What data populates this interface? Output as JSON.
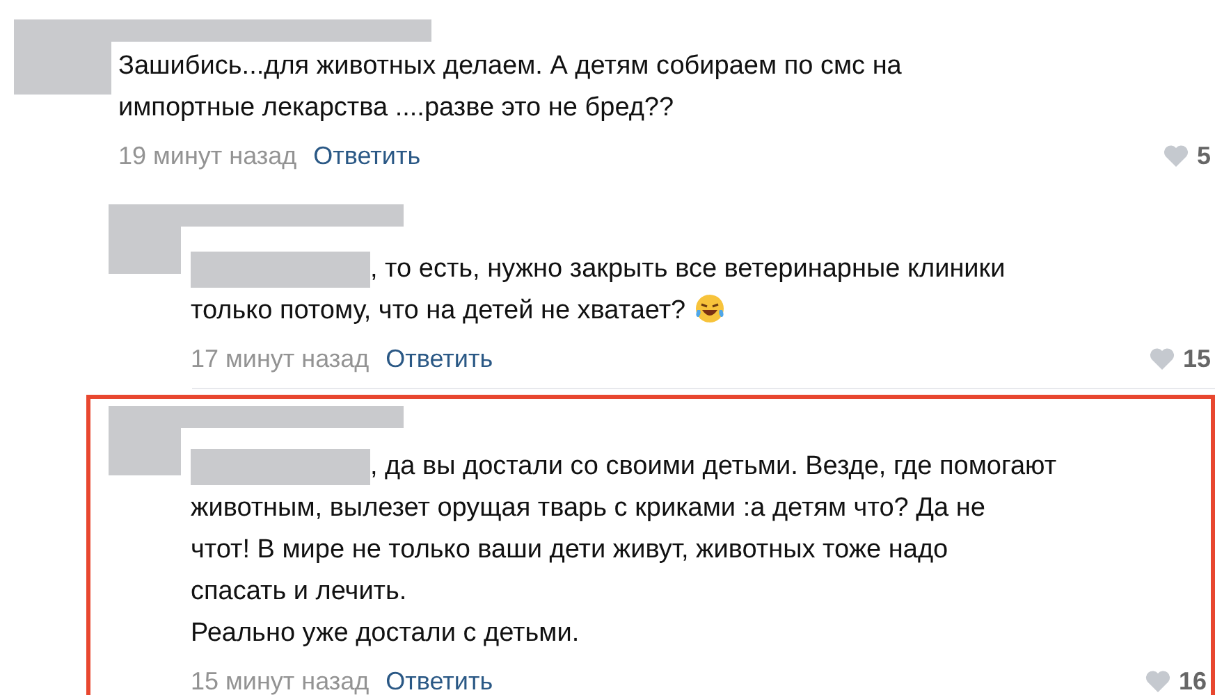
{
  "comments": [
    {
      "redacted_reply_to": false,
      "highlighted": false,
      "trailing_emoji": false,
      "lines": [
        "Зашибись...для животных делаем. А детям собираем по смс на",
        "импортные лекарства ....разве это не бред??"
      ],
      "time": "19 минут назад",
      "reply": "Ответить",
      "likes": "5"
    },
    {
      "redacted_reply_to": true,
      "highlighted": false,
      "trailing_emoji": true,
      "lines": [
        ", то есть, нужно закрыть все ветеринарные клиники",
        "только потому, что на детей не хватает?"
      ],
      "time": "17 минут назад",
      "reply": "Ответить",
      "likes": "15"
    },
    {
      "redacted_reply_to": true,
      "highlighted": true,
      "trailing_emoji": false,
      "lines": [
        ", да вы достали со своими детьми. Везде, где помогают",
        "животным, вылезет орущая тварь с криками :а детям что? Да не",
        "чтот! В мире не только ваши дети живут, животных тоже надо",
        "спасать и лечить.",
        "Реально уже достали с детьми."
      ],
      "time": "15 минут назад",
      "reply": "Ответить",
      "likes": "16"
    }
  ]
}
